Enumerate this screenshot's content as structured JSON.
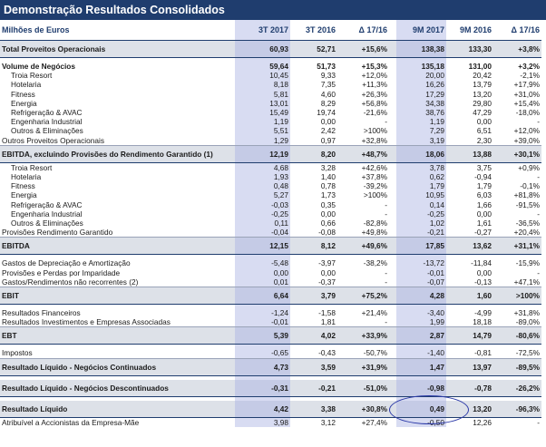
{
  "title": "Demonstração Resultados Consolidados",
  "header": {
    "label": "Milhões de Euros",
    "col1": "3T 2017",
    "col2": "3T 2016",
    "col3": "Δ 17/16",
    "col4": "9M 2017",
    "col5": "9M 2016",
    "col6": "Δ 17/16"
  },
  "rows": [
    {
      "type": "tot",
      "label": "Total Proveitos Operacionais",
      "v": [
        "60,93",
        "52,71",
        "+15,6%",
        "138,38",
        "133,30",
        "+3,8%"
      ]
    },
    {
      "type": "gap"
    },
    {
      "type": "bold",
      "label": "Volume de Negócios",
      "v": [
        "59,64",
        "51,73",
        "+15,3%",
        "135,18",
        "131,00",
        "+3,2%"
      ]
    },
    {
      "type": "sub",
      "label": "Troia Resort",
      "v": [
        "10,45",
        "9,33",
        "+12,0%",
        "20,00",
        "20,42",
        "-2,1%"
      ]
    },
    {
      "type": "sub",
      "label": "Hotelaria",
      "v": [
        "8,18",
        "7,35",
        "+11,3%",
        "16,26",
        "13,79",
        "+17,9%"
      ]
    },
    {
      "type": "sub",
      "label": "Fitness",
      "v": [
        "5,81",
        "4,60",
        "+26,3%",
        "17,29",
        "13,20",
        "+31,0%"
      ]
    },
    {
      "type": "sub",
      "label": "Energia",
      "v": [
        "13,01",
        "8,29",
        "+56,8%",
        "34,38",
        "29,80",
        "+15,4%"
      ]
    },
    {
      "type": "sub",
      "label": "Refrigeração & AVAC",
      "v": [
        "15,49",
        "19,74",
        "-21,6%",
        "38,76",
        "47,29",
        "-18,0%"
      ]
    },
    {
      "type": "sub",
      "label": "Engenharia Industrial",
      "v": [
        "1,19",
        "0,00",
        "-",
        "1,19",
        "0,00",
        "-"
      ]
    },
    {
      "type": "sub",
      "label": "Outros & Eliminações",
      "v": [
        "5,51",
        "2,42",
        ">100%",
        "7,29",
        "6,51",
        "+12,0%"
      ]
    },
    {
      "type": "sep",
      "label": "Outros Proveitos Operacionais",
      "v": [
        "1,29",
        "0,97",
        "+32,8%",
        "3,19",
        "2,30",
        "+39,0%"
      ]
    },
    {
      "type": "tot",
      "label": "EBITDA, excluindo Provisões do Rendimento Garantido (1)",
      "v": [
        "12,19",
        "8,20",
        "+48,7%",
        "18,06",
        "13,88",
        "+30,1%"
      ]
    },
    {
      "type": "sub",
      "label": "Troia Resort",
      "v": [
        "4,68",
        "3,28",
        "+42,6%",
        "3,78",
        "3,75",
        "+0,9%"
      ]
    },
    {
      "type": "sub",
      "label": "Hotelaria",
      "v": [
        "1,93",
        "1,40",
        "+37,8%",
        "0,62",
        "-0,94",
        "-"
      ]
    },
    {
      "type": "sub",
      "label": "Fitness",
      "v": [
        "0,48",
        "0,78",
        "-39,2%",
        "1,79",
        "1,79",
        "-0,1%"
      ]
    },
    {
      "type": "sub",
      "label": "Energia",
      "v": [
        "5,27",
        "1,73",
        ">100%",
        "10,95",
        "6,03",
        "+81,8%"
      ]
    },
    {
      "type": "sub",
      "label": "Refrigeração & AVAC",
      "v": [
        "-0,03",
        "0,35",
        "-",
        "0,14",
        "1,66",
        "-91,5%"
      ]
    },
    {
      "type": "sub",
      "label": "Engenharia Industrial",
      "v": [
        "-0,25",
        "0,00",
        "-",
        "-0,25",
        "0,00",
        "-"
      ]
    },
    {
      "type": "sub",
      "label": "Outros & Eliminações",
      "v": [
        "0,11",
        "0,66",
        "-82,8%",
        "1,02",
        "1,61",
        "-36,5%"
      ]
    },
    {
      "type": "sep",
      "label": "Provisões Rendimento Garantido",
      "v": [
        "-0,04",
        "-0,08",
        "+49,8%",
        "-0,21",
        "-0,27",
        "+20,4%"
      ]
    },
    {
      "type": "tot",
      "label": "EBITDA",
      "v": [
        "12,15",
        "8,12",
        "+49,6%",
        "17,85",
        "13,62",
        "+31,1%"
      ]
    },
    {
      "type": "gap"
    },
    {
      "type": "plain",
      "label": "Gastos de Depreciação e Amortização",
      "v": [
        "-5,48",
        "-3,97",
        "-38,2%",
        "-13,72",
        "-11,84",
        "-15,9%"
      ]
    },
    {
      "type": "plain",
      "label": "Provisões e Perdas por Imparidade",
      "v": [
        "0,00",
        "0,00",
        "-",
        "-0,01",
        "0,00",
        "-"
      ]
    },
    {
      "type": "sep",
      "label": "Gastos/Rendimentos não recorrentes (2)",
      "v": [
        "0,01",
        "-0,37",
        "-",
        "-0,07",
        "-0,13",
        "+47,1%"
      ]
    },
    {
      "type": "tot",
      "label": "EBIT",
      "v": [
        "6,64",
        "3,79",
        "+75,2%",
        "4,28",
        "1,60",
        ">100%"
      ]
    },
    {
      "type": "gap"
    },
    {
      "type": "plain",
      "label": "Resultados Financeiros",
      "v": [
        "-1,24",
        "-1,58",
        "+21,4%",
        "-3,40",
        "-4,99",
        "+31,8%"
      ]
    },
    {
      "type": "sep",
      "label": "Resultados Investimentos e Empresas Associadas",
      "v": [
        "-0,01",
        "1,81",
        "-",
        "1,99",
        "18,18",
        "-89,0%"
      ]
    },
    {
      "type": "tot",
      "label": "EBT",
      "v": [
        "5,39",
        "4,02",
        "+33,9%",
        "2,87",
        "14,79",
        "-80,6%"
      ]
    },
    {
      "type": "gap"
    },
    {
      "type": "sep",
      "label": "Impostos",
      "v": [
        "-0,65",
        "-0,43",
        "-50,7%",
        "-1,40",
        "-0,81",
        "-72,5%"
      ]
    },
    {
      "type": "tot",
      "label": "Resultado Líquido - Negócios Continuados",
      "v": [
        "4,73",
        "3,59",
        "+31,9%",
        "1,47",
        "13,97",
        "-89,5%"
      ]
    },
    {
      "type": "gap"
    },
    {
      "type": "tot",
      "label": "Resultado Líquido - Negócios Descontinuados",
      "v": [
        "-0,31",
        "-0,21",
        "-51,0%",
        "-0,98",
        "-0,78",
        "-26,2%"
      ]
    },
    {
      "type": "gap"
    },
    {
      "type": "tot",
      "label": "Resultado Líquido",
      "v": [
        "4,42",
        "3,38",
        "+30,8%",
        "0,49",
        "13,20",
        "-96,3%"
      ]
    },
    {
      "type": "plain",
      "label": "Atribuível a Accionistas da Empresa-Mãe",
      "v": [
        "3,98",
        "3,12",
        "+27,4%",
        "-0,50",
        "12,26",
        "-"
      ]
    }
  ]
}
